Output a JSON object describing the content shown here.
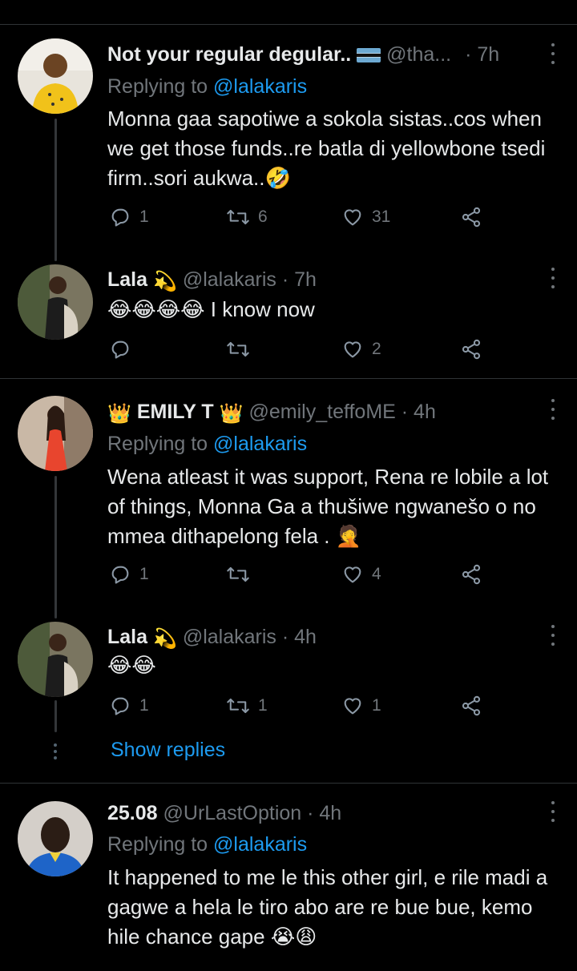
{
  "tweets": [
    {
      "name": "Not your regular degular..",
      "handle": "@tha...",
      "time": "· 7h",
      "replying_label": "Replying to",
      "replying_to": "@lalakaris",
      "text": "Monna gaa sapotiwe a sokola sistas..cos when we get those funds..re batla di yellowbone tsedi firm..sori aukwa..🤣",
      "replies": "1",
      "retweets": "6",
      "likes": "31"
    },
    {
      "name": "Lala",
      "name_emoji": "💫",
      "handle": "@lalakaris · 7h",
      "text": "😂😂😂😂 I know now",
      "replies": "",
      "retweets": "",
      "likes": "2"
    },
    {
      "name_prefix": "👑",
      "name": "EMILY T",
      "name_suffix": "👑",
      "handle": "@emily_teffoME · 4h",
      "replying_label": "Replying to",
      "replying_to": "@lalakaris",
      "text": "Wena atleast it was support, Rena re lobile a lot of things, Monna Ga a thušiwe ngwanešo o no mmea dithapelong fela . 🤦",
      "replies": "1",
      "retweets": "",
      "likes": "4"
    },
    {
      "name": "Lala",
      "name_emoji": "💫",
      "handle": "@lalakaris · 4h",
      "text": "😂😂",
      "replies": "1",
      "retweets": "1",
      "likes": "1"
    },
    {
      "name": "25.08",
      "handle": "@UrLastOption · 4h",
      "replying_label": "Replying to",
      "replying_to": "@lalakaris",
      "text": "It happened to me le this other girl, e rile madi a gagwe a hela le tiro abo are re bue bue, kemo hile chance gape 😭😩"
    }
  ],
  "show_replies": "Show replies",
  "colors": {
    "accent": "#1d9bf0",
    "muted": "#71767b",
    "background": "#000000"
  },
  "icons": [
    "reply-icon",
    "retweet-icon",
    "like-icon",
    "share-icon",
    "more-icon",
    "flag-icon"
  ]
}
